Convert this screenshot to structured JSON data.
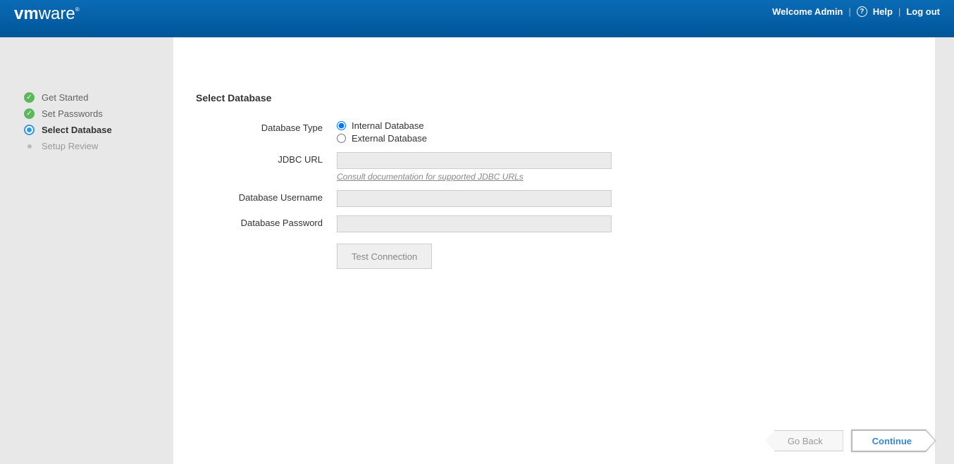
{
  "header": {
    "logo_vm": "vm",
    "logo_ware": "ware",
    "welcome": "Welcome Admin",
    "help": "Help",
    "logout": "Log out"
  },
  "sidebar": {
    "steps": [
      {
        "label": "Get Started",
        "state": "done"
      },
      {
        "label": "Set Passwords",
        "state": "done"
      },
      {
        "label": "Select Database",
        "state": "current"
      },
      {
        "label": "Setup Review",
        "state": "todo"
      }
    ]
  },
  "main": {
    "title": "Select Database",
    "labels": {
      "db_type": "Database Type",
      "jdbc_url": "JDBC URL",
      "db_username": "Database Username",
      "db_password": "Database Password"
    },
    "radios": {
      "internal": "Internal Database",
      "external": "External Database",
      "selected": "internal"
    },
    "fields": {
      "jdbc_url": "",
      "db_username": "",
      "db_password": ""
    },
    "helper_link": "Consult documentation for supported JDBC URLs",
    "test_connection": "Test Connection"
  },
  "footer": {
    "back": "Go Back",
    "continue": "Continue"
  }
}
